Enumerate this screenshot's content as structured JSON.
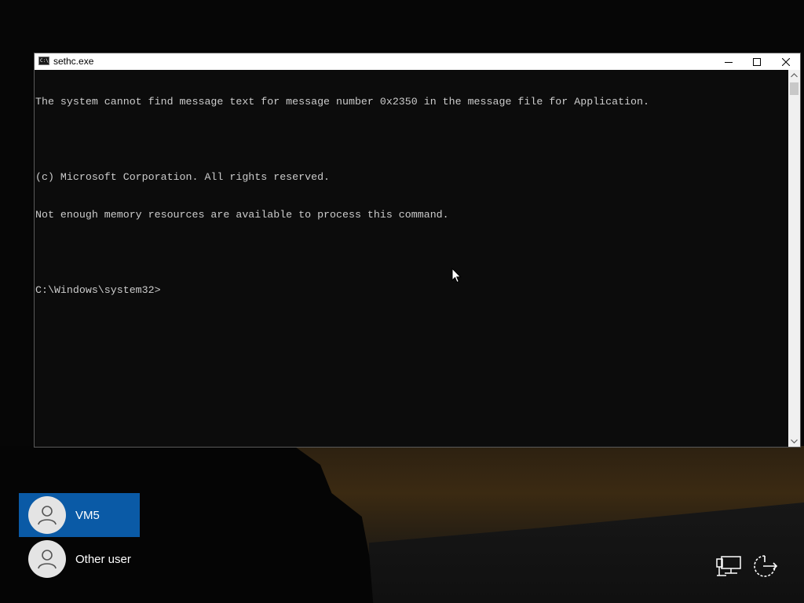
{
  "window": {
    "title": "sethc.exe",
    "icon": "cmd-icon",
    "buttons": [
      "minimize-icon",
      "maximize-icon",
      "close-icon"
    ]
  },
  "console": {
    "lines": [
      "The system cannot find message text for message number 0x2350 in the message file for Application.",
      "",
      "(c) Microsoft Corporation. All rights reserved.",
      "Not enough memory resources are available to process this command.",
      "",
      "C:\\Windows\\system32>"
    ],
    "text_color": "#cccccc",
    "background_color": "#0c0c0c"
  },
  "users": [
    {
      "name": "VM5",
      "selected": true,
      "icon": "user-avatar-icon"
    },
    {
      "name": "Other user",
      "selected": false,
      "icon": "user-avatar-icon"
    }
  ],
  "system_icons": [
    "network-icon",
    "power-icon"
  ],
  "accent_color": "#0a5aa6"
}
